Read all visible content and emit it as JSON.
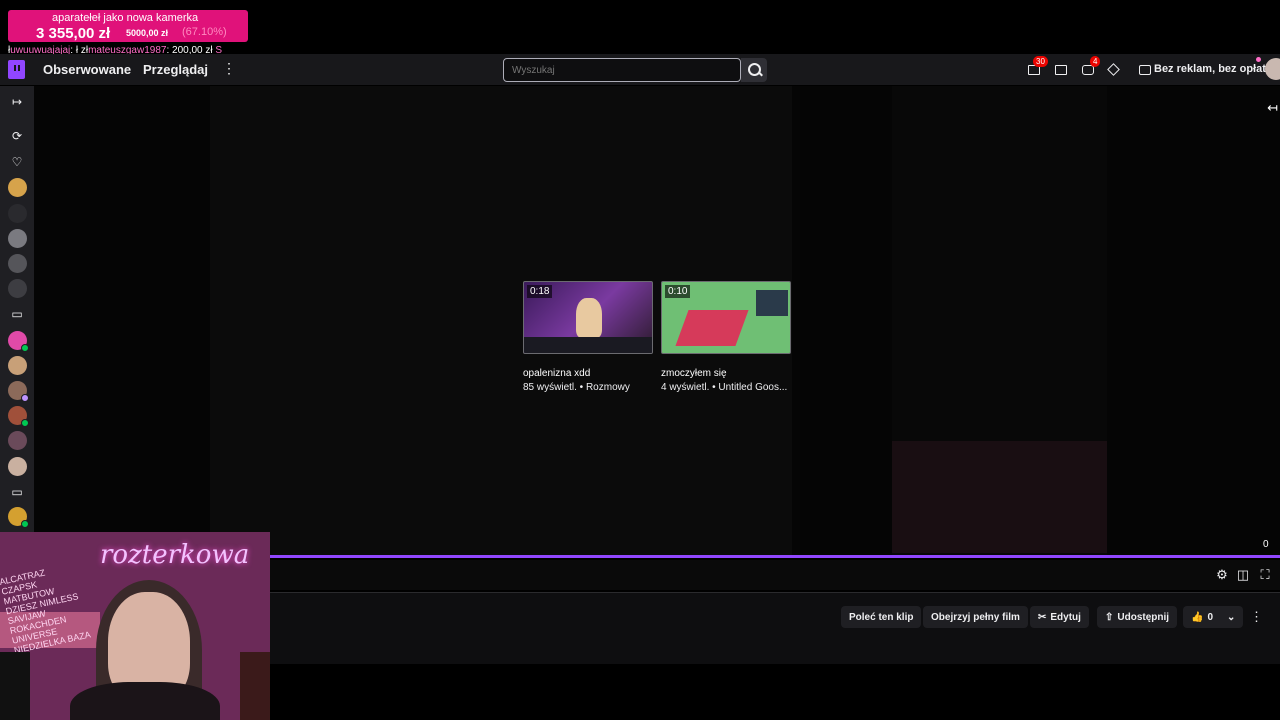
{
  "donation": {
    "goal_title": "aparatełeł jako nowa kamerka",
    "amount": "3 355,00 zł",
    "target": "5000,00 zł",
    "percent": "(67.10%)",
    "ticker": [
      {
        "prefix": "ł",
        "name": "uwuuwuajajaj",
        "amount": ": "
      },
      {
        "prefix": " ł zł",
        "name": "mateuszgaw1987",
        "amount": ": 200,00 zł"
      },
      {
        "prefix": " ",
        "name": "S",
        "amount": ""
      }
    ]
  },
  "nav": {
    "following": "Obserwowane",
    "browse": "Przeglądaj",
    "more": "⋮",
    "search_placeholder": "Wyszukaj",
    "notifications_count": "30",
    "whispers_count": "4",
    "no_ads": "Bez reklam, bez opłat"
  },
  "player": {
    "collapse_icon": "collapse-arrow-icon",
    "clips": [
      {
        "duration": "0:18",
        "title": "opalenizna xdd",
        "meta": "85 wyświetl. • Rozmowy"
      },
      {
        "duration": "0:10",
        "title": "zmoczyłem się",
        "meta": "4 wyświetl. • Untitled Goos..."
      }
    ],
    "progress_count": "0",
    "progress_fraction": 1.0
  },
  "actions": {
    "recommend": "Poleć ten klip",
    "watch_full": "Obejrzyj pełny film",
    "edit": "Edytuj",
    "share": "Udostępnij",
    "likes": "0"
  },
  "webcam": {
    "neon_sign": "rozterkowa",
    "note": "ALCATRAZ CZAPSK MATBUTOW DZIESZ NIMLESS SAVIJAW ROKACHDEN UNIVERSE NIEDZIELKA BAZA"
  },
  "colors": {
    "accent": "#9147ff",
    "background": "#0e0e10",
    "surface": "#18181b",
    "badge": "#eb0400",
    "donation": "#e0127a"
  }
}
